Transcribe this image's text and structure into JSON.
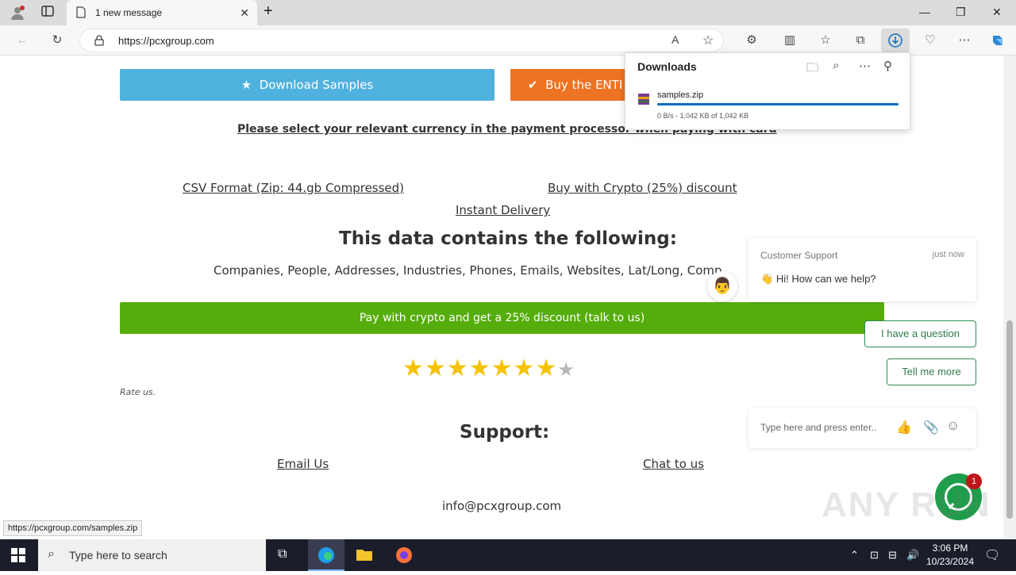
{
  "browser": {
    "tab_title": "1 new message",
    "url": "https://pcxgroup.com",
    "status_url": "https://pcxgroup.com/samples.zip"
  },
  "downloads": {
    "title": "Downloads",
    "file_name": "samples.zip",
    "detail": "0 B/s - 1,042 KB of 1,042 KB",
    "progress": 1.0
  },
  "page": {
    "download_samples": "Download Samples",
    "buy_button": "Buy the ENTI",
    "currency_note": "Please select your relevant currency in the payment processor when paying with card",
    "csv_format": "CSV Format (Zip: 44.gb Compressed)",
    "buy_crypto": "Buy with Crypto (25%) discount",
    "instant_delivery": "Instant Delivery",
    "contains_heading": "This data contains the following:",
    "contains_list": "Companies, People, Addresses, Industries, Phones, Emails, Websites, Lat/Long, Comp",
    "crypto_bar": "Pay with crypto and get a 25% discount (talk to us)",
    "rating": {
      "value": 6,
      "max": 7
    },
    "rate_us": "Rate us.",
    "support_heading": "Support:",
    "email_us": "Email Us",
    "chat_to_us": "Chat to us",
    "email": "info@pcxgroup.com"
  },
  "chat": {
    "agent": "Customer Support",
    "time": "just now",
    "message": "Hi! How can we help?",
    "option_1": "I have a question",
    "option_2": "Tell me more",
    "input_placeholder": "Type here and press enter..",
    "badge": "1"
  },
  "watermark": "ANY RUN",
  "taskbar": {
    "search_placeholder": "Type here to search",
    "time": "3:06 PM",
    "date": "10/23/2024"
  }
}
